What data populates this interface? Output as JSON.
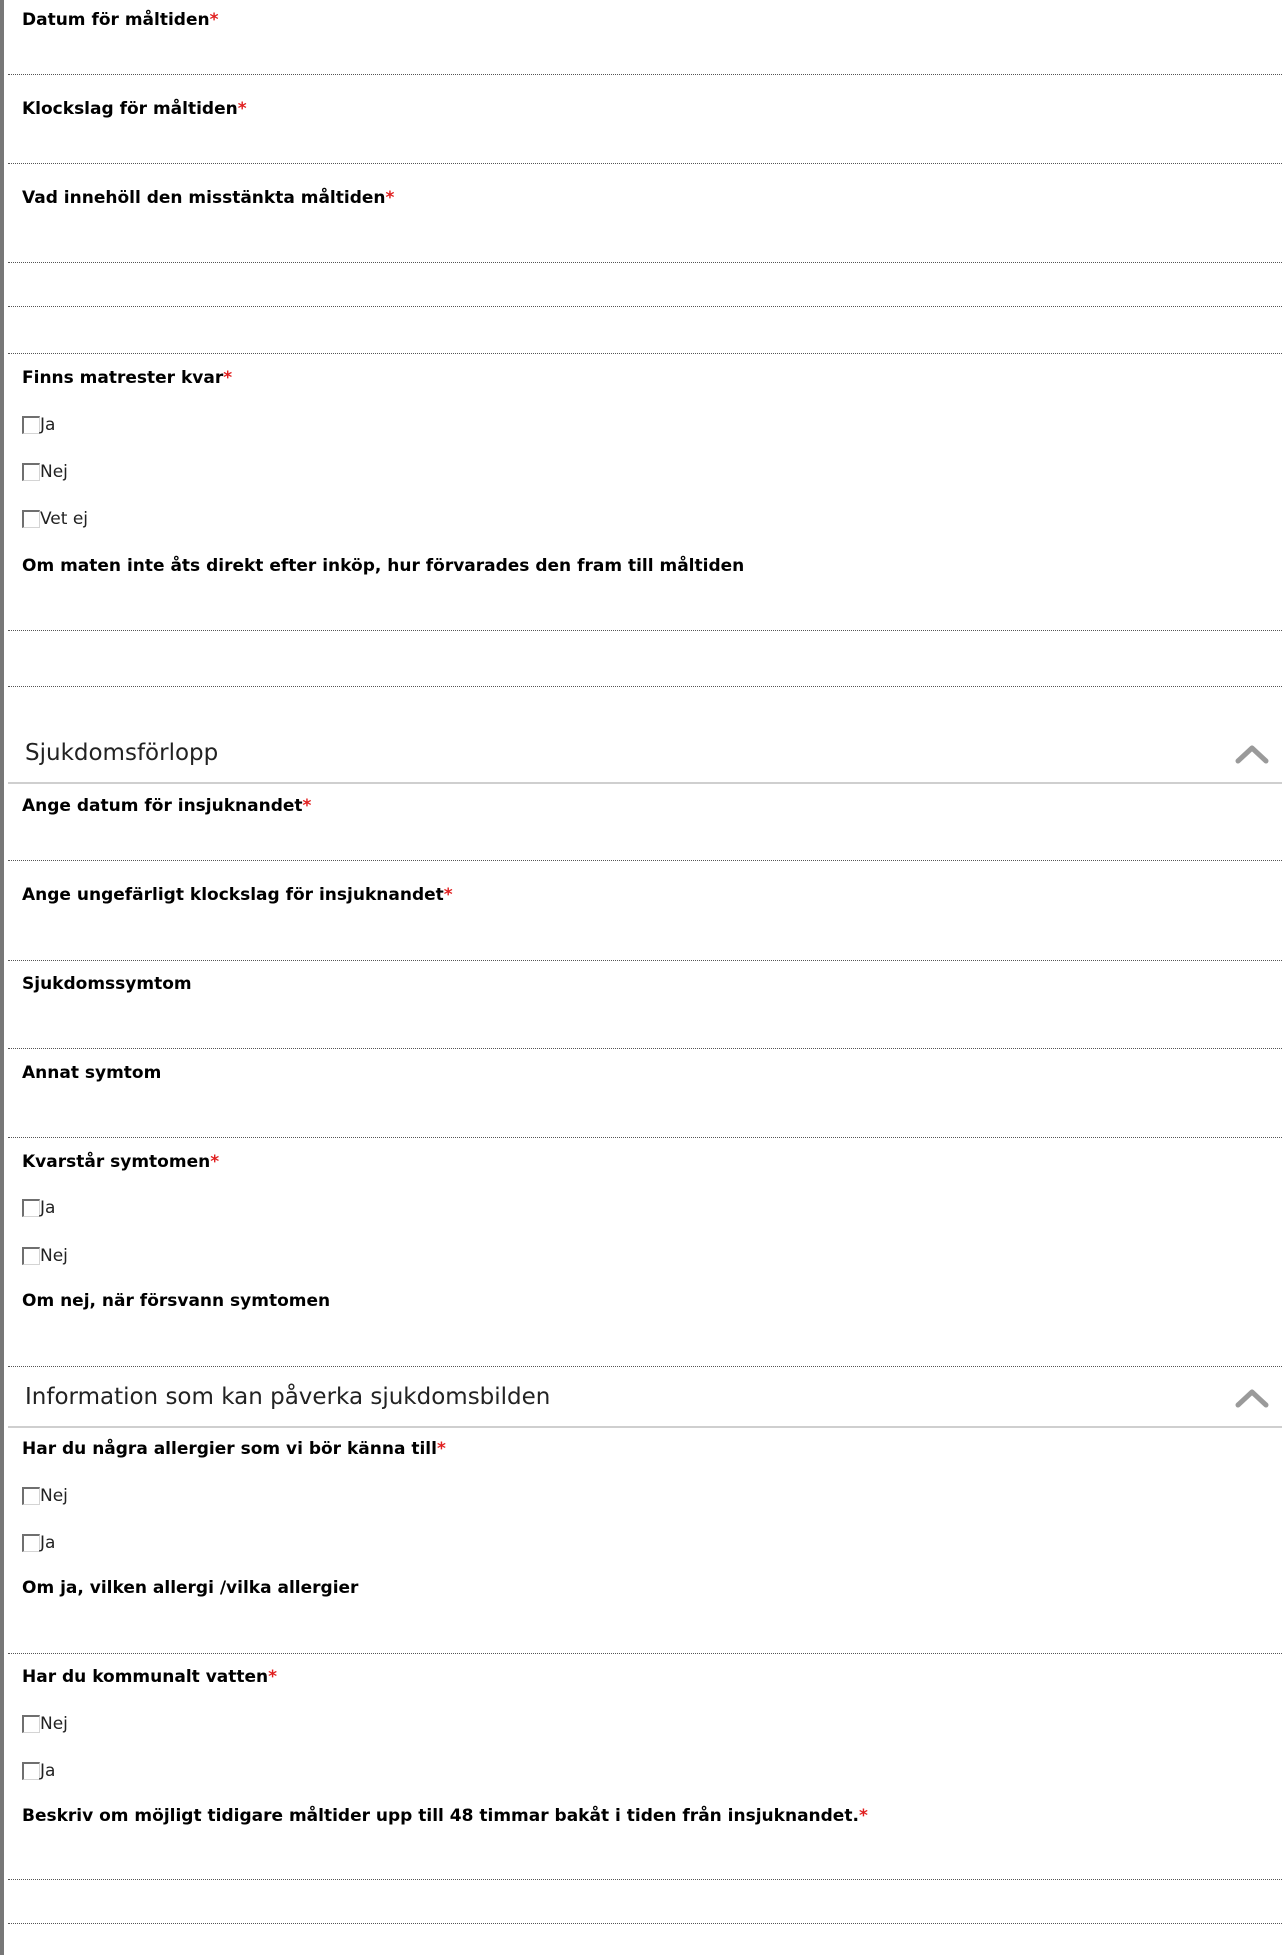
{
  "required_marker": "*",
  "meal": {
    "date_label": "Datum för måltiden",
    "time_label": "Klockslag för måltiden",
    "contents_label": "Vad innehöll den misstänkta måltiden",
    "leftovers_label": "Finns matrester kvar",
    "leftovers_options": [
      "Ja",
      "Nej",
      "Vet ej"
    ],
    "storage_label": "Om maten inte åts direkt efter inköp, hur förvarades den fram till måltiden"
  },
  "section_illness": {
    "title": "Sjukdomsförlopp",
    "onset_date_label": "Ange datum för insjuknandet",
    "onset_time_label": "Ange ungefärligt klockslag för insjuknandet",
    "symptoms_label": "Sjukdomssymtom",
    "other_symptom_label": "Annat symtom",
    "persist_label": "Kvarstår symtomen",
    "persist_options": [
      "Ja",
      "Nej"
    ],
    "disappeared_label": "Om nej, när försvann symtomen"
  },
  "section_info": {
    "title": "Information som kan påverka sjukdomsbilden",
    "allergy_label": "Har du några allergier som vi bör känna till",
    "allergy_options": [
      "Nej",
      "Ja"
    ],
    "allergy_which_label": "Om ja, vilken allergi /vilka allergier",
    "water_label": "Har du kommunalt vatten",
    "water_options": [
      "Nej",
      "Ja"
    ],
    "earlier_meals_label": "Beskriv om möjligt tidigare måltider upp till 48 timmar bakåt i tiden från insjuknandet."
  },
  "icons": {
    "collapse": "chevron-up-icon",
    "checkbox": "checkbox-unchecked-icon"
  },
  "colors": {
    "required": "#e02020",
    "left_rule": "#777777",
    "section_rule": "#cfcfcf",
    "chevron": "#9a9a9a"
  }
}
